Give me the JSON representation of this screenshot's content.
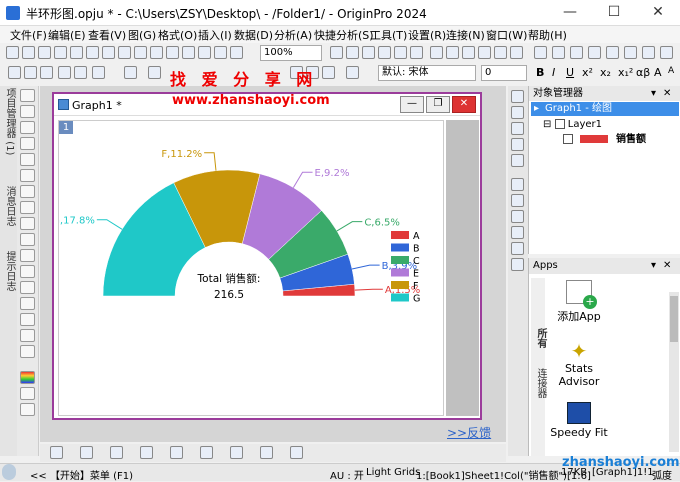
{
  "window": {
    "title": "半环形图.opju * - C:\\Users\\ZSY\\Desktop\\ - /Folder1/ - OriginPro 2024",
    "min": "—",
    "max": "☐",
    "close": "✕"
  },
  "menu": [
    "文件(F)",
    "编辑(E)",
    "查看(V)",
    "图(G)",
    "格式(O)",
    "插入(I)",
    "数据(D)",
    "分析(A)",
    "快捷分析(S)",
    "工具(T)",
    "设置(R)",
    "连接(N)",
    "窗口(W)",
    "帮助(H)"
  ],
  "toolbar": {
    "zoom": "100%",
    "font": "默认: 宋体",
    "fontsize": "0"
  },
  "left_panels": [
    "项目管理器 (1)",
    "消息日志",
    "提示日志"
  ],
  "graph": {
    "title": "Graph1 *",
    "layer": "1"
  },
  "chart_data": {
    "type": "pie",
    "subtype": "half-donut",
    "center_label": "Total 销售额:",
    "center_value": "216.5",
    "slices": [
      {
        "name": "A",
        "value": 1.5,
        "label": "A,1.5%",
        "color": "#e03a3a"
      },
      {
        "name": "B",
        "value": 3.9,
        "label": "B,3.9%",
        "color": "#2f66d8"
      },
      {
        "name": "C",
        "value": 6.5,
        "label": "C,6.5%",
        "color": "#3aaa6a"
      },
      {
        "name": "E",
        "value": 9.2,
        "label": "E,9.2%",
        "color": "#b07ad8"
      },
      {
        "name": "F",
        "value": 11.2,
        "label": "F,11.2%",
        "color": "#c8960a"
      },
      {
        "name": "G",
        "value": 17.8,
        "label": "G,17.8%",
        "color": "#1fc8c8"
      }
    ],
    "legend": [
      "A",
      "B",
      "C",
      "E",
      "F",
      "G"
    ],
    "legend_position": "right"
  },
  "link": ">>反馈",
  "objmgr": {
    "title": "对象管理器",
    "graph": "Graph1 - 绘图",
    "layer": "Layer1",
    "plot": "销售额"
  },
  "apps": {
    "title": "Apps",
    "tabs": [
      "所有",
      "连接器"
    ],
    "items": [
      "添加App",
      "Stats Advisor",
      "Speedy Fit"
    ]
  },
  "status": {
    "start": "【开始】菜单 (F1)",
    "au": "AU : 开",
    "grids": "Light Grids",
    "book": "1:[Book1]Sheet1!Col(\"销售额\")[1:6]",
    "size": "17KB",
    "graph": "[Graph1]1!1",
    "unit": "弧度"
  },
  "watermarks": {
    "w1": "找 爱 分 享 网",
    "w2": "www.zhanshaoyi.com",
    "w3": "zhanshaoyi.com"
  }
}
